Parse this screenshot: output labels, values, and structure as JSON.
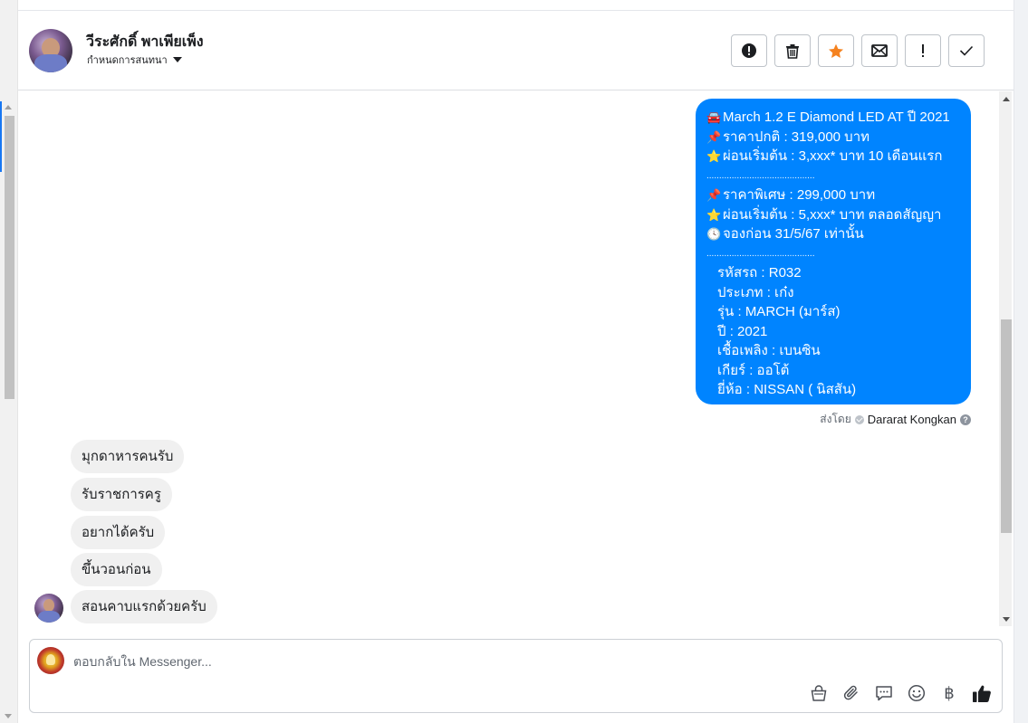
{
  "header": {
    "contact_name": "วีระศักดิ์ พาเพียเพ็ง",
    "sub_label": "กำหนดการสนทนา",
    "actions": [
      {
        "name": "report-spam-button",
        "icon": "alert-circle-icon"
      },
      {
        "name": "delete-button",
        "icon": "trash-icon"
      },
      {
        "name": "star-button",
        "icon": "star-icon"
      },
      {
        "name": "mark-unread-button",
        "icon": "envelope-icon"
      },
      {
        "name": "important-button",
        "icon": "exclamation-icon"
      },
      {
        "name": "done-button",
        "icon": "check-icon"
      }
    ],
    "star_color": "#f5821f"
  },
  "outgoing": {
    "lines": [
      {
        "emoji": "🚘",
        "text": "March 1.2 E Diamond LED AT ปี 2021"
      },
      {
        "emoji": "📌",
        "text": "ราคาปกติ : 319,000 บาท"
      },
      {
        "emoji": "⭐",
        "text": "ผ่อนเริ่มต้น : 3,xxx* บาท 10 เดือนแรก"
      },
      {
        "sep": "..........................................."
      },
      {
        "emoji": "📌",
        "text": "ราคาพิเศษ : 299,000 บาท"
      },
      {
        "emoji": "⭐",
        "text": "ผ่อนเริ่มต้น : 5,xxx* บาท ตลอดสัญญา"
      },
      {
        "emoji": "🕓",
        "text": "จองก่อน 31/5/67 เท่านั้น"
      },
      {
        "sep": "..........................................."
      },
      {
        "text": "รหัสรถ : R032"
      },
      {
        "text": "ประเภท : เก๋ง"
      },
      {
        "text": "รุ่น : MARCH (มาร์ส)"
      },
      {
        "text": "ปี : 2021"
      },
      {
        "text": "เชื้อเพลิง : เบนซิน"
      },
      {
        "text": "เกียร์ : ออโต้"
      },
      {
        "text": "ยี่ห้อ : NISSAN ( นิสสัน)"
      }
    ],
    "sent_by_prefix": "ส่งโดย",
    "sent_by_name": "Dararat Kongkan",
    "bubble_color": "#0084ff"
  },
  "incoming": [
    "มุกดาหารคนรับ",
    "รับราชการครู",
    "อยากได้ครับ",
    "ขึ้นวอนก่อน",
    "สอนคาบแรกด้วยครับ"
  ],
  "composer": {
    "placeholder": "ตอบกลับใน Messenger...",
    "tools": [
      "bag-icon",
      "paperclip-icon",
      "chat-bubble-icon",
      "smiley-icon",
      "baht-icon",
      "thumbs-up-icon"
    ],
    "baht_symbol": "฿"
  }
}
